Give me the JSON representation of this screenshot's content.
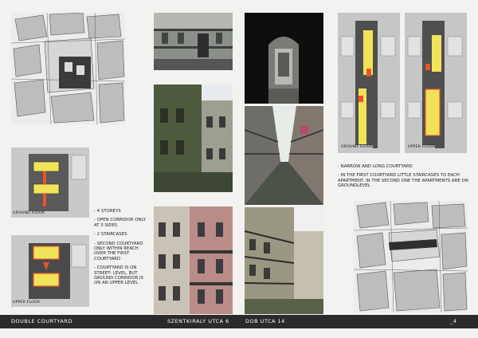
{
  "captions": {
    "ground_floor_left": "GROUND FLOOR",
    "upper_floor_left": "UPPER FLOOR",
    "ground_floor_right": "GROUND FLOOR",
    "upper_floor_right": "UPPER FLOOR"
  },
  "left_notes": [
    "- 4 STOREYS",
    "- OPEN CORRIDOR ONLY AT 3 SIDES",
    "- 2 STAIRCASES",
    "- SECOND COURTYARD ONLY WITHIN REACH OVER THE FIRST COURTYARD",
    "- COURTYARD IS ON STREET- LEVEL, BUT GROUND CORRIDOR IS ON AN UPPER LEVEL"
  ],
  "right_notes": [
    "- NARROW AND LONG COURTYARD",
    "- IN THE FIRST COURTYARD LITTLE STAIRCASES TO EACH APARTMENT. IN THE SECOND ONE THE APARTMENTS ARE ON GROUNDLEVEL"
  ],
  "footer": {
    "title": "DOUBLE COURTYARD",
    "street1": "SZENTKIRALY UTCA 6",
    "street2": "DOB UTCA 14",
    "page": "4"
  },
  "colors": {
    "yellow": "#f0e35a",
    "orange": "#e8552a",
    "dark": "#4a4a4a"
  }
}
